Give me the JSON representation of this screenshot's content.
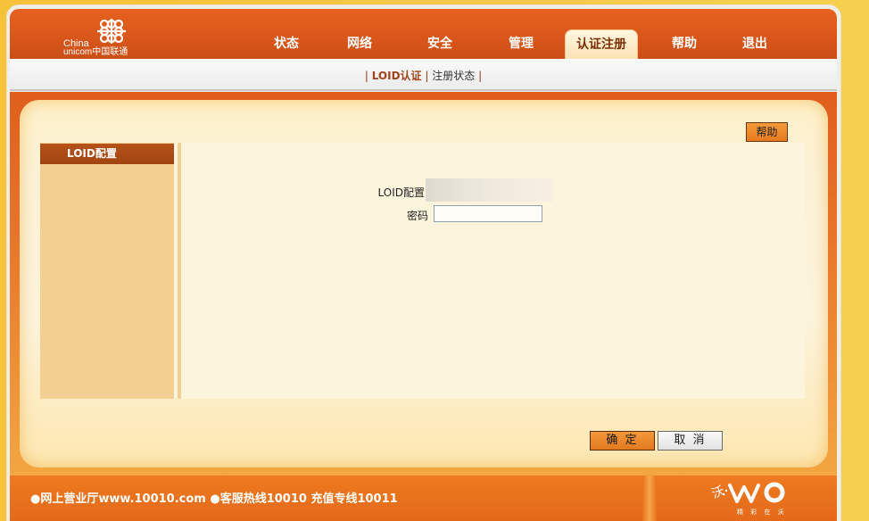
{
  "brand": {
    "logo_line1": "China",
    "logo_line2": "unicom中国联通"
  },
  "nav": {
    "items": [
      {
        "label": "状态"
      },
      {
        "label": "网络"
      },
      {
        "label": "安全"
      },
      {
        "label": "管理"
      },
      {
        "label": "认证注册",
        "active": true
      },
      {
        "label": "帮助"
      },
      {
        "label": "退出"
      }
    ]
  },
  "subnav": {
    "sep": "|",
    "active": "LOID认证",
    "link": "注册状态"
  },
  "help_button": "帮助",
  "sidebar": {
    "header": "LOID配置"
  },
  "form": {
    "loid_label": "LOID配置",
    "password_label": "密码",
    "password_value": ""
  },
  "buttons": {
    "ok": "确 定",
    "cancel": "取 消"
  },
  "footer": {
    "text": "●网上营业厅www.10010.com ●客服热线10010 充值专线10011",
    "wo_sub": "精 彩 在 沃",
    "wo_char": "沃"
  },
  "colors": {
    "brand_orange": "#d8561a",
    "accent_brown": "#a2440f",
    "background_yellow": "#f6c23a"
  }
}
